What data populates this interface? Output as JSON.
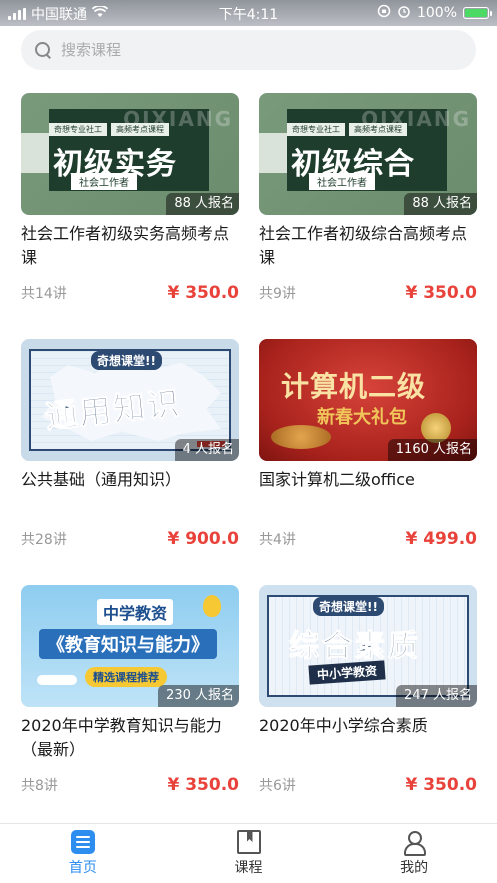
{
  "status_bar": {
    "carrier": "中国联通",
    "time": "下午4:11",
    "battery": "100%"
  },
  "search": {
    "placeholder": "搜索课程"
  },
  "courses": [
    {
      "title": "社会工作者初级实务高频考点课",
      "enrolled": "88 人报名",
      "lessons": "共14讲",
      "price": "¥ 350.0",
      "art": {
        "tag1": "奇想专业社工",
        "tag2": "高频考点课程",
        "big": "初级实务",
        "sub": "社会工作者",
        "word": "QIXIANG"
      }
    },
    {
      "title": "社会工作者初级综合高频考点课",
      "enrolled": "88 人报名",
      "lessons": "共9讲",
      "price": "¥ 350.0",
      "art": {
        "tag1": "奇想专业社工",
        "tag2": "高频考点课程",
        "big": "初级综合",
        "sub": "社会工作者",
        "word": "QIXIANG"
      }
    },
    {
      "title": "公共基础（通用知识）",
      "enrolled": "4 人报名",
      "lessons": "共28讲",
      "price": "¥ 900.0",
      "art": {
        "tag": "奇想课堂!!",
        "big": "通用知识"
      }
    },
    {
      "title": "国家计算机二级office",
      "enrolled": "1160 人报名",
      "lessons": "共4讲",
      "price": "¥ 499.0",
      "art": {
        "big": "计算机二级",
        "sub": "新春大礼包"
      }
    },
    {
      "title": "2020年中学教育知识与能力（最新）",
      "enrolled": "230 人报名",
      "lessons": "共8讲",
      "price": "¥ 350.0",
      "art": {
        "tag": "中学教资",
        "big": "《教育知识与能力》",
        "pill": "精选课程推荐"
      }
    },
    {
      "title": "2020年中小学综合素质",
      "enrolled": "247 人报名",
      "lessons": "共6讲",
      "price": "¥ 350.0",
      "art": {
        "tag": "奇想课堂!!",
        "big": "综合素质",
        "sub": "中小学教资"
      }
    }
  ],
  "tabbar": {
    "items": [
      {
        "label": "首页",
        "icon": "home-list-icon",
        "active": true
      },
      {
        "label": "课程",
        "icon": "book-icon",
        "active": false
      },
      {
        "label": "我的",
        "icon": "user-icon",
        "active": false
      }
    ]
  },
  "colors": {
    "accent": "#2e8ef0",
    "price": "#e8423a"
  }
}
